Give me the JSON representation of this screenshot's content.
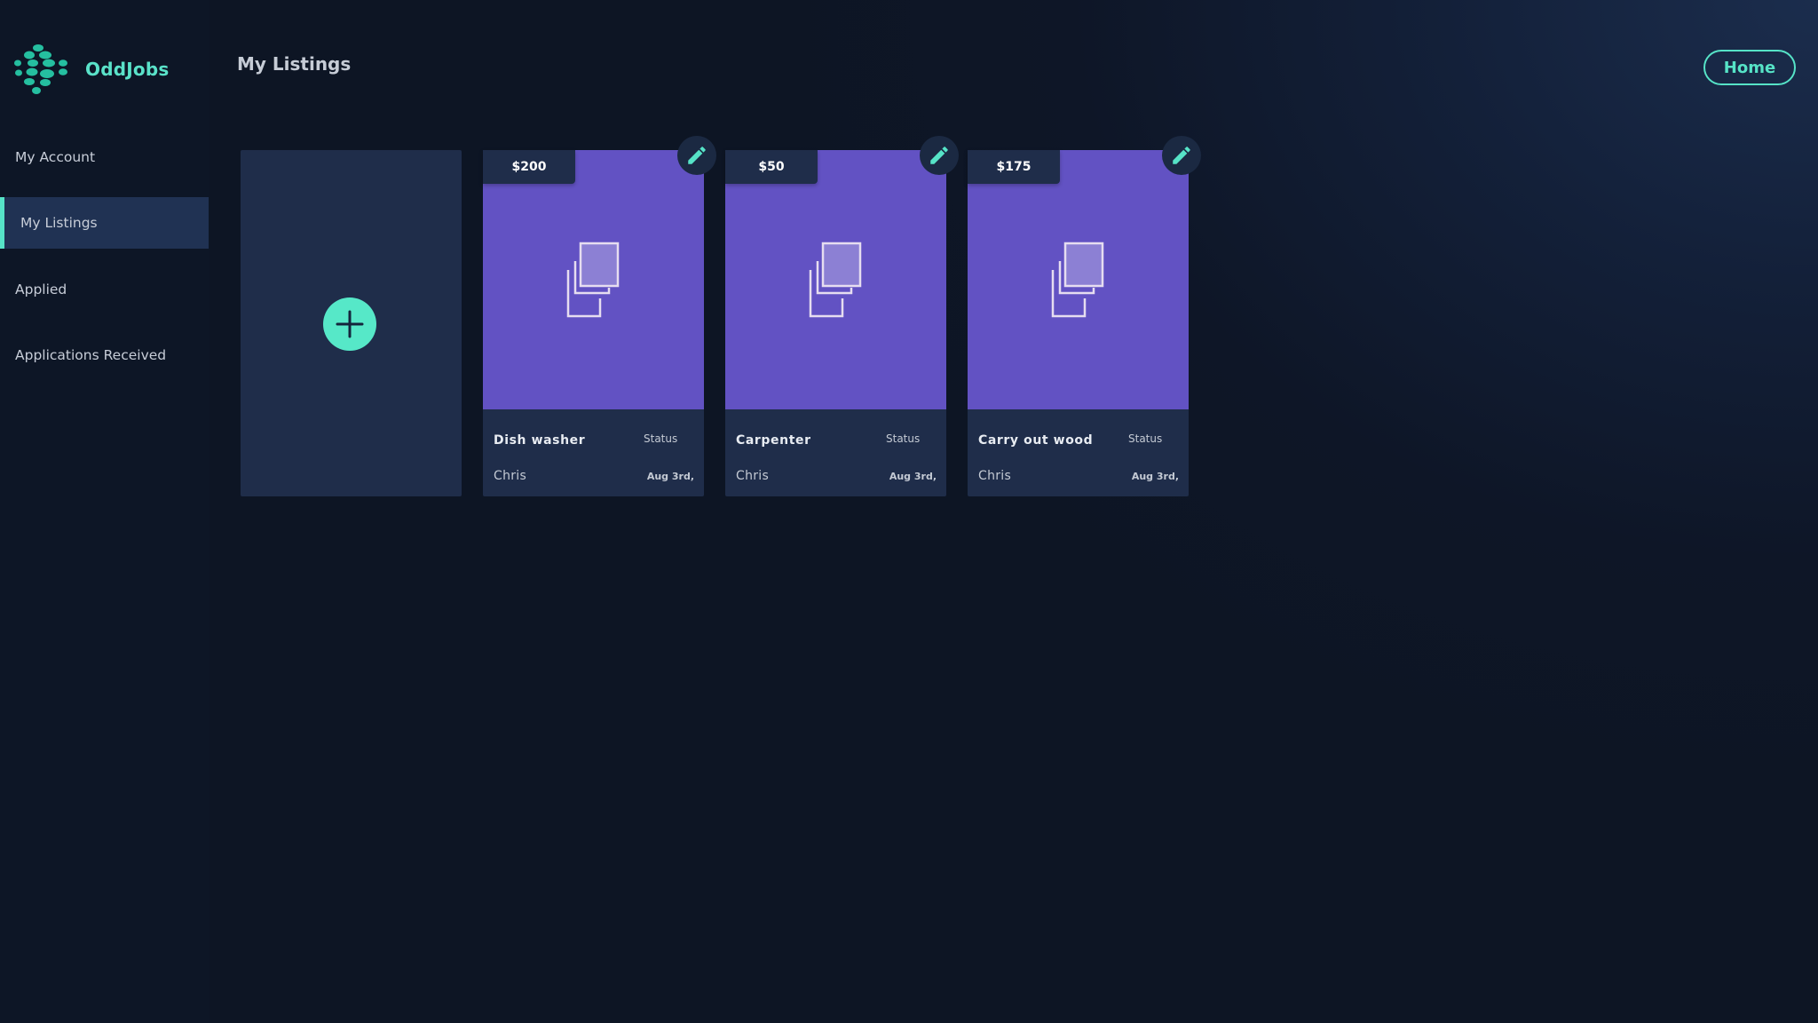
{
  "app": {
    "name": "OddJobs",
    "logo_icon": "dotted-circle-logo-icon",
    "accent_color": "#56e3c7"
  },
  "sidebar": {
    "items": [
      {
        "label": "My Account",
        "active": false
      },
      {
        "label": "My Listings",
        "active": true
      },
      {
        "label": "Applied",
        "active": false
      },
      {
        "label": "Applications Received",
        "active": false
      }
    ]
  },
  "header": {
    "title": "My Listings",
    "home_label": "Home"
  },
  "add_card": {
    "icon": "plus-icon"
  },
  "listings": [
    {
      "price": "$200",
      "title": "Dish washer",
      "status": "Status",
      "owner": "Chris",
      "date": "Aug 3rd,",
      "image_icon": "image-placeholder-icon",
      "edit_icon": "pencil-icon"
    },
    {
      "price": "$50",
      "title": "Carpenter",
      "status": "Status",
      "owner": "Chris",
      "date": "Aug 3rd,",
      "image_icon": "image-placeholder-icon",
      "edit_icon": "pencil-icon"
    },
    {
      "price": "$175",
      "title": "Carry out wood",
      "status": "Status",
      "owner": "Chris",
      "date": "Aug 3rd,",
      "image_icon": "image-placeholder-icon",
      "edit_icon": "pencil-icon"
    }
  ]
}
